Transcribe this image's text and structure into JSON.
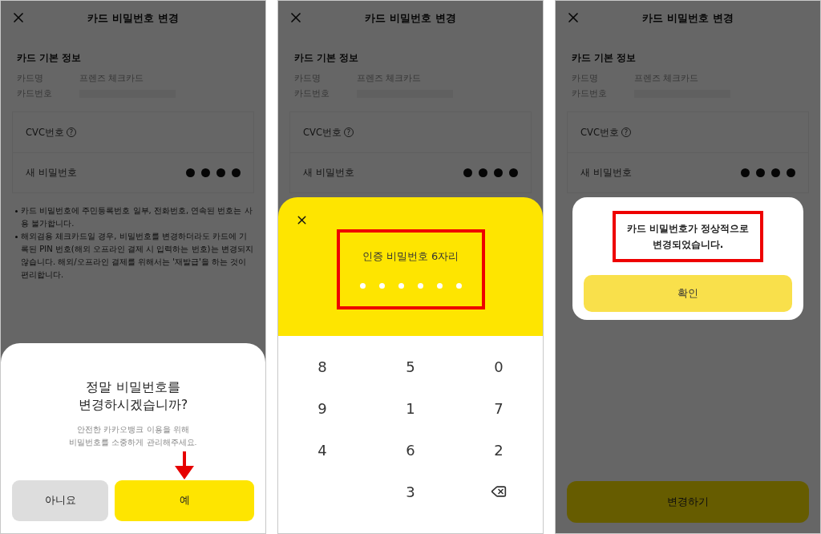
{
  "screens": [
    {
      "background": {
        "title": "카드 비밀번호 변경",
        "section_title": "카드 기본 정보",
        "info_rows": [
          {
            "label": "카드명",
            "value": "프렌즈 체크카드",
            "masked": false
          },
          {
            "label": "카드번호",
            "masked": true
          }
        ],
        "cvc_label": "CVC번호",
        "help_mark": "?",
        "new_password_label": "새 비밀번호",
        "pin": [
          {
            "filled": true
          },
          {
            "filled": true
          },
          {
            "filled": true
          },
          {
            "filled": true
          }
        ],
        "notes": [
          {
            "text": "카드 비밀번호에 주민등록번호 일부, 전화번호, 연속된 번호는 사용 불가합니다."
          },
          {
            "text": "해외겸용 체크카드일 경우, 비밀번호를 변경하더라도 카드에 기록된 PIN 번호(해외 오프라인 결제 시 입력하는 번호)는 변경되지 않습니다. 해외/오프라인 결제를 위해서는 '재발급'을 하는 것이 편리합니다."
          }
        ]
      },
      "overlay": {
        "kind": "confirm_sheet",
        "title": "정말 비밀번호를\n변경하시겠습니까?",
        "message": "안전한 카카오뱅크 이용을 위해\n비밀번호를 소중하게 관리해주세요.",
        "pointer_arrow": true,
        "buttons": [
          {
            "label": "아니요",
            "kind": "secondary"
          },
          {
            "label": "예",
            "kind": "primary"
          }
        ]
      }
    },
    {
      "background": {
        "title": "카드 비밀번호 변경",
        "section_title": "카드 기본 정보",
        "info_rows": [
          {
            "label": "카드명",
            "value": "프렌즈 체크카드",
            "masked": false
          },
          {
            "label": "카드번호",
            "masked": true
          }
        ],
        "cvc_label": "CVC번호",
        "help_mark": "?",
        "new_password_label": "새 비밀번호",
        "pin": [
          {
            "filled": true
          },
          {
            "filled": true
          },
          {
            "filled": true
          },
          {
            "filled": true
          }
        ]
      },
      "overlay": {
        "kind": "keypad_sheet",
        "title": "인증 비밀번호 6자리",
        "highlighted": true,
        "pin": [
          {
            "filled": false
          },
          {
            "filled": false
          },
          {
            "filled": false
          },
          {
            "filled": false
          },
          {
            "filled": false
          },
          {
            "filled": false
          }
        ],
        "keys": [
          {
            "kind": "digit",
            "label": "8"
          },
          {
            "kind": "digit",
            "label": "5"
          },
          {
            "kind": "digit",
            "label": "0"
          },
          {
            "kind": "digit",
            "label": "9"
          },
          {
            "kind": "digit",
            "label": "1"
          },
          {
            "kind": "digit",
            "label": "7"
          },
          {
            "kind": "digit",
            "label": "4"
          },
          {
            "kind": "digit",
            "label": "6"
          },
          {
            "kind": "digit",
            "label": "2"
          },
          {
            "kind": "blank"
          },
          {
            "kind": "digit",
            "label": "3"
          },
          {
            "kind": "backspace"
          }
        ]
      }
    },
    {
      "background": {
        "title": "카드 비밀번호 변경",
        "section_title": "카드 기본 정보",
        "info_rows": [
          {
            "label": "카드명",
            "value": "프렌즈 체크카드",
            "masked": false
          },
          {
            "label": "카드번호",
            "masked": true
          }
        ],
        "cvc_label": "CVC번호",
        "help_mark": "?",
        "new_password_label": "새 비밀번호",
        "pin": [
          {
            "filled": true
          },
          {
            "filled": true
          },
          {
            "filled": true
          },
          {
            "filled": true
          }
        ],
        "submit": "변경하기"
      },
      "overlay": {
        "kind": "alert_dialog",
        "message": "카드 비밀번호가 정상적으로\n변경되었습니다.",
        "highlighted": true,
        "button": "확인"
      }
    }
  ]
}
